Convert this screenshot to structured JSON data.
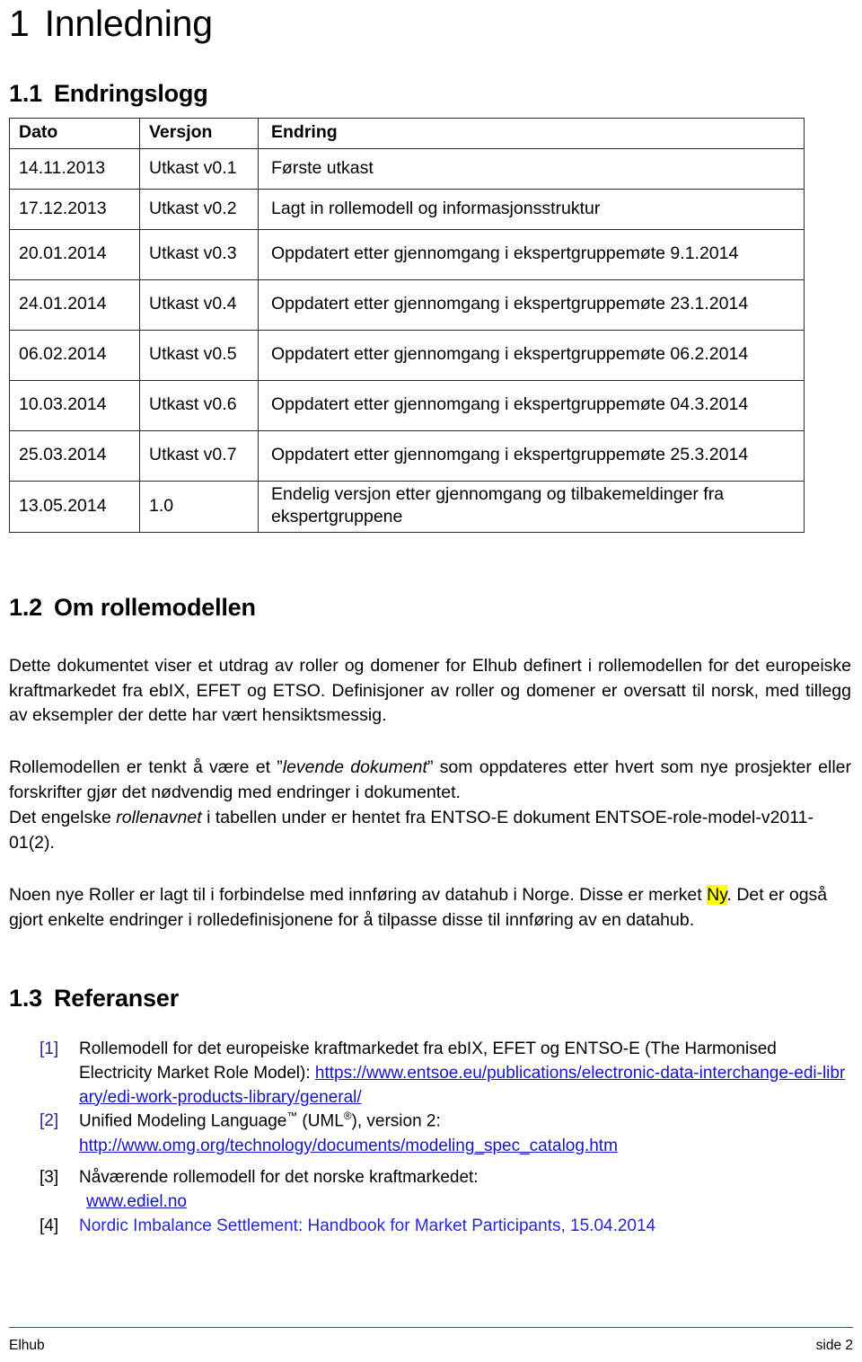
{
  "document": {
    "chapter_heading": {
      "number": "1",
      "title": "Innledning"
    },
    "footer": {
      "left": "Elhub",
      "right": "side 2"
    },
    "rule_color": "#2f6b3c",
    "highlight_color": "#ffff00",
    "link_color": "#1414c8"
  },
  "changelog_section": {
    "heading": {
      "number": "1.1",
      "title": "Endringslogg"
    },
    "table": {
      "columns": [
        "Dato",
        "Versjon",
        "Endring"
      ],
      "rows": [
        {
          "dato": "14.11.2013",
          "versjon": "Utkast v0.1",
          "endring": "Første utkast",
          "lines": 1
        },
        {
          "dato": "17.12.2013",
          "versjon": "Utkast v0.2",
          "endring": "Lagt in rollemodell og informasjonsstruktur",
          "lines": 1
        },
        {
          "dato": "20.01.2014",
          "versjon": "Utkast v0.3",
          "endring": "Oppdatert etter gjennomgang i ekspertgruppemøte 9.1.2014",
          "lines": 2
        },
        {
          "dato": "24.01.2014",
          "versjon": "Utkast v0.4",
          "endring": "Oppdatert etter gjennomgang i ekspertgruppemøte 23.1.2014",
          "lines": 2
        },
        {
          "dato": "06.02.2014",
          "versjon": "Utkast v0.5",
          "endring": "Oppdatert etter gjennomgang i ekspertgruppemøte 06.2.2014",
          "lines": 2
        },
        {
          "dato": "10.03.2014",
          "versjon": "Utkast v0.6",
          "endring": "Oppdatert etter gjennomgang i ekspertgruppemøte 04.3.2014",
          "lines": 2
        },
        {
          "dato": "25.03.2014",
          "versjon": "Utkast v0.7",
          "endring": "Oppdatert etter gjennomgang i ekspertgruppemøte 25.3.2014",
          "lines": 2
        },
        {
          "dato": "13.05.2014",
          "versjon": "1.0",
          "endring": "Endelig versjon etter gjennomgang og tilbakemeldinger fra ekspertgruppene",
          "lines": 2
        }
      ]
    }
  },
  "about_section": {
    "heading": {
      "number": "1.2",
      "title": "Om rollemodellen"
    },
    "paragraph_intro": "Dette dokumentet viser et utdrag av roller og domener for Elhub definert i rollemodellen for det europeiske kraftmarkedet fra ebIX, EFET og ETSO. Definisjoner av roller og domener er oversatt til norsk, med tillegg av eksempler der dette har vært hensiktsmessig.",
    "paragraph_living": {
      "before": "Rollemodellen er tenkt å være et ”",
      "italic": "levende dokument",
      "after": "” som oppdateres etter hvert som nye prosjekter eller forskrifter gjør det nødvendig med endringer i dokumentet."
    },
    "paragraph_english": {
      "before": "Det engelske ",
      "italic": "rollenavnet",
      "after": " i tabellen under er hentet fra ENTSO-E dokument ENTSOE-role-model-v2011-01(2)."
    },
    "paragraph_new_roles": {
      "before": "Noen nye Roller er lagt til i forbindelse med innføring av datahub i Norge. Disse er merket ",
      "highlight": "Ny",
      "after": ". Det er også gjort enkelte endringer i rolledefinisjonene for å tilpasse disse til innføring av en datahub."
    }
  },
  "references_section": {
    "heading": {
      "number": "1.3",
      "title": "Referanser"
    },
    "items": [
      {
        "marker": "[1]",
        "marker_style": "blue",
        "text": "Rollemodell for det europeiske kraftmarkedet fra ebIX, EFET og ENTSO-E (The Harmonised Electricity Market Role Model): ",
        "link": "https://www.entsoe.eu/publications/electronic-data-interchange-edi-library/edi-work-products-library/general/",
        "link_style": "underline"
      },
      {
        "marker": "[2]",
        "marker_style": "blue",
        "text_prefix": "Unified Modeling Language",
        "tm": "™",
        "text_mid": " (UML",
        "reg": "®",
        "text_suffix": "), version 2:",
        "link": "http://www.omg.org/technology/documents/modeling_spec_catalog.htm",
        "link_style": "underline"
      },
      {
        "marker": "[3]",
        "marker_style": "black",
        "text": "Nåværende rollemodell for det norske kraftmarkedet:",
        "link": "www.ediel.no",
        "link_style": "underline"
      },
      {
        "marker": "[4]",
        "marker_style": "black",
        "link": "Nordic Imbalance Settlement: Handbook for Market Participants, 15.04.2014",
        "link_style": "plain"
      }
    ]
  }
}
